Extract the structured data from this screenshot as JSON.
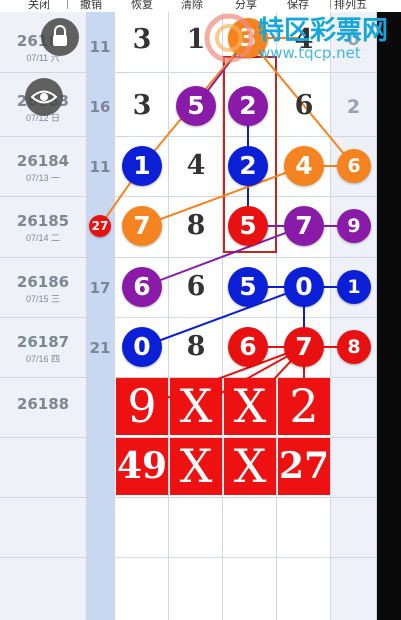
{
  "toolbar": {
    "items": [
      {
        "label": "关闭"
      },
      {
        "label": "撤销"
      },
      {
        "label": "恢复"
      },
      {
        "label": "清除"
      },
      {
        "label": "分享"
      },
      {
        "label": "保存"
      },
      {
        "label": "排列五"
      }
    ]
  },
  "watermark": {
    "name": "特区彩票网",
    "url": "www.tqcp.net"
  },
  "rows": [
    {
      "issue": "26182",
      "date": "07/11 六",
      "miss": "11"
    },
    {
      "issue": "26183",
      "date": "07/12 日",
      "miss": "16"
    },
    {
      "issue": "26184",
      "date": "07/13 一",
      "miss": "11"
    },
    {
      "issue": "26185",
      "date": "07/14 二",
      "miss": "27"
    },
    {
      "issue": "26186",
      "date": "07/15 三",
      "miss": "17"
    },
    {
      "issue": "26187",
      "date": "07/16 四",
      "miss": "21"
    },
    {
      "issue": "26188",
      "date": "",
      "miss": ""
    }
  ],
  "grid": {
    "r0": {
      "c0": "3",
      "c1": "1",
      "c2": "3",
      "c3": "4",
      "side": "0"
    },
    "r1": {
      "c0": "3",
      "c1": "5",
      "c2": "2",
      "c3": "6",
      "side": "2"
    },
    "r2": {
      "c0": "1",
      "c1": "4",
      "c2": "2",
      "c3": "4",
      "side": "6"
    },
    "r3": {
      "c0": "7",
      "c1": "8",
      "c2": "5",
      "c3": "7",
      "side": "9"
    },
    "r4": {
      "c0": "6",
      "c1": "6",
      "c2": "5",
      "c3": "0",
      "side": "1"
    },
    "r5": {
      "c0": "0",
      "c1": "8",
      "c2": "6",
      "c3": "7",
      "side": "8"
    }
  },
  "prediction": {
    "top": [
      "9",
      "X",
      "X",
      "2"
    ],
    "bottom": [
      "49",
      "X",
      "X",
      "27"
    ]
  },
  "colors": {
    "red": "#e81010",
    "blue": "#0a1fd6",
    "purple": "#8a1aa8",
    "orange": "#f5831f",
    "frame": "#c0281c"
  }
}
